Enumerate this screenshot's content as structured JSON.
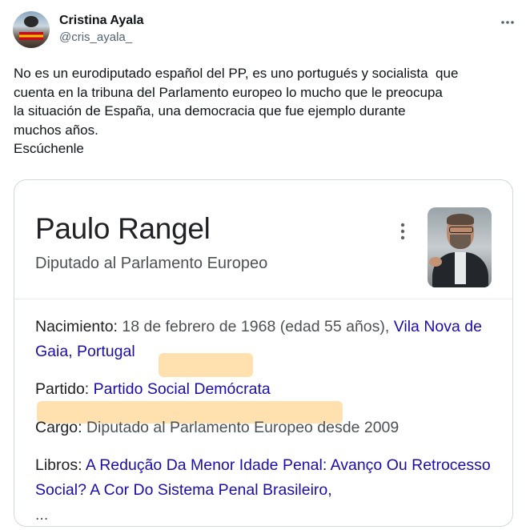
{
  "header": {
    "display_name": "Cristina Ayala",
    "handle": "@cris_ayala_",
    "more_icon": "more-horizontal-icon"
  },
  "tweet_text": "No es un eurodiputado español del PP, es uno portugués y socialista  que\ncuenta en la tribuna del Parlamento europeo lo mucho que le preocupa\nla situación de España, una democracia que fue ejemplo durante\nmuchos años.\nEscúchenle",
  "card": {
    "name": "Paulo Rangel",
    "subtitle": "Diputado al Parlamento Europeo",
    "facts": {
      "birth_label": "Nacimiento:",
      "birth_value": " 18 de febrero de 1968 (edad 55 años), ",
      "birth_link": "Vila Nova de Gaia, Portugal",
      "party_label": "Partido:",
      "party_link": "Partido Social Demócrata",
      "post_label": "Cargo:",
      "post_value": " Diputado al Parlamento Europeo desde 2009",
      "books_label": "Libros:",
      "books_link": "A Redução Da Menor Idade Penal: Avanço Ou Retrocesso Social? A Cor Do Sistema Penal Brasileiro,",
      "books_more": "..."
    }
  },
  "colors": {
    "link": "#1a0dab",
    "highlight": "#fdc86e",
    "muted": "#536471"
  }
}
